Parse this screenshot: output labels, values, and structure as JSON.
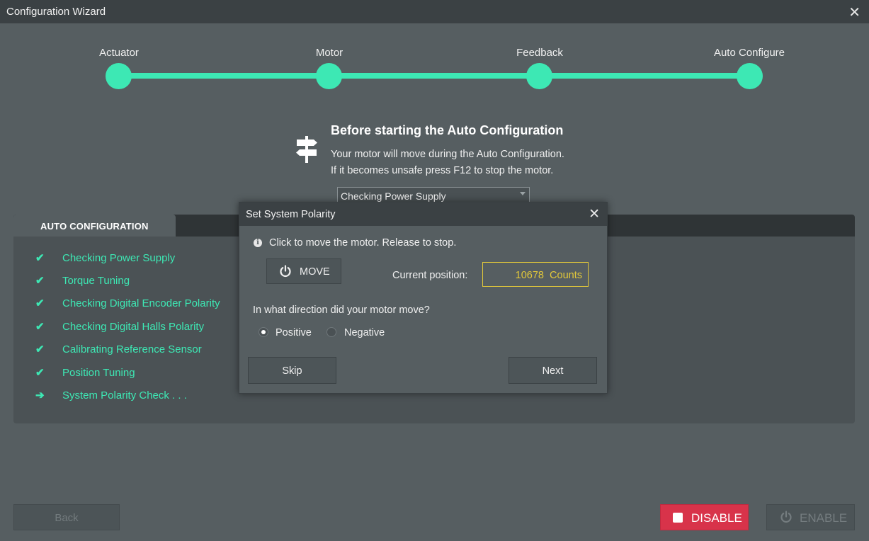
{
  "window": {
    "title": "Configuration Wizard"
  },
  "steps": [
    {
      "label": "Actuator"
    },
    {
      "label": "Motor"
    },
    {
      "label": "Feedback"
    },
    {
      "label": "Auto Configure"
    }
  ],
  "info": {
    "title": "Before starting the Auto Configuration",
    "line1": "Your motor will move during the Auto Configuration.",
    "line2": "If it becomes unsafe press F12 to stop the motor.",
    "combo_value": "Checking Power Supply"
  },
  "panel": {
    "tab_label": "AUTO CONFIGURATION",
    "tasks": [
      {
        "label": "Checking Power Supply",
        "status": "done"
      },
      {
        "label": "Torque Tuning",
        "status": "done"
      },
      {
        "label": "Checking Digital Encoder Polarity",
        "status": "done"
      },
      {
        "label": "Checking Digital Halls Polarity",
        "status": "done"
      },
      {
        "label": "Calibrating Reference Sensor",
        "status": "done"
      },
      {
        "label": "Position Tuning",
        "status": "done"
      },
      {
        "label": "System Polarity Check  . . .",
        "status": "in-progress"
      }
    ]
  },
  "footer": {
    "back_label": "Back",
    "disable_label": "DISABLE",
    "enable_label": "ENABLE"
  },
  "dialog": {
    "title": "Set System Polarity",
    "info_text": "Click to move the motor. Release to stop.",
    "move_label": "MOVE",
    "position_label": "Current position:",
    "position_value": "10678  Counts",
    "question": "In what direction did your motor move?",
    "options": [
      {
        "label": "Positive",
        "selected": true
      },
      {
        "label": "Negative",
        "selected": false
      }
    ],
    "skip_label": "Skip",
    "next_label": "Next"
  },
  "colors": {
    "accent": "#3de8b4",
    "danger": "#d8334a",
    "highlight": "#e2c83a"
  },
  "icons": {
    "task_done": "check-icon",
    "task_in_progress": "arrow-right-icon",
    "info_sign": "signpost-icon",
    "power": "power-icon"
  }
}
